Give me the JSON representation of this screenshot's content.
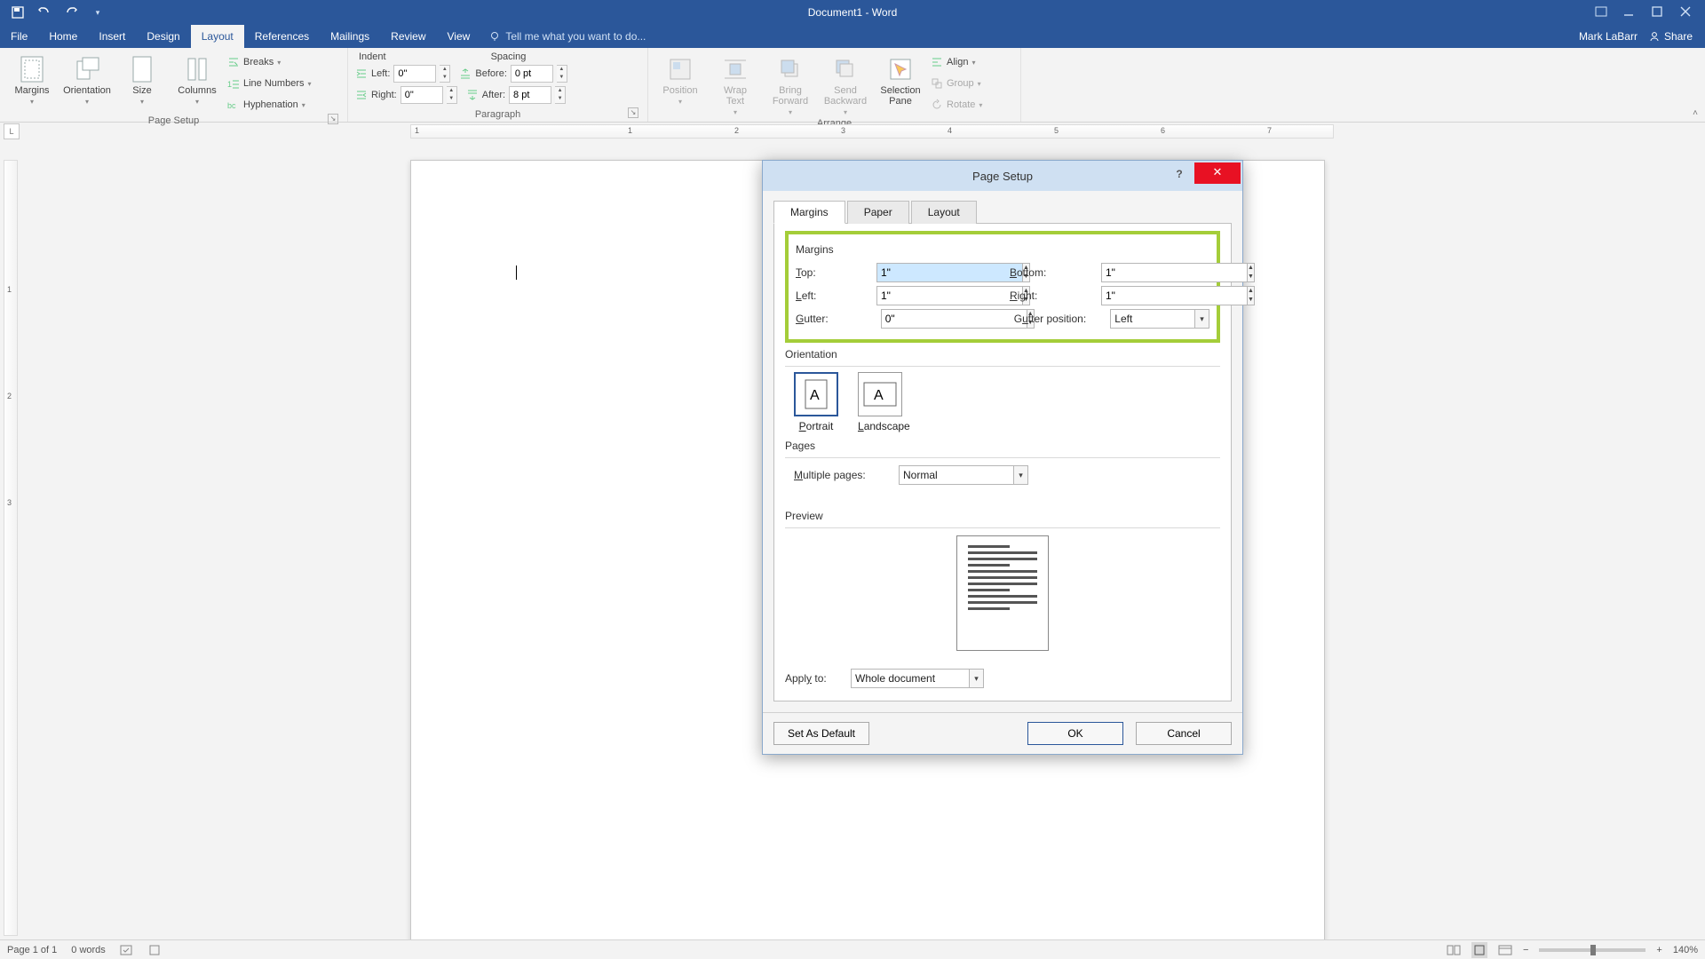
{
  "app": {
    "title": "Document1 - Word",
    "user": "Mark LaBarr",
    "share": "Share"
  },
  "qat": {
    "save": "save",
    "undo": "undo",
    "redo": "redo"
  },
  "tabs": [
    "File",
    "Home",
    "Insert",
    "Design",
    "Layout",
    "References",
    "Mailings",
    "Review",
    "View"
  ],
  "active_tab": "Layout",
  "tellme": "Tell me what you want to do...",
  "ribbon": {
    "pagesetup": {
      "label": "Page Setup",
      "margins": "Margins",
      "orientation": "Orientation",
      "size": "Size",
      "columns": "Columns",
      "breaks": "Breaks",
      "linenumbers": "Line Numbers",
      "hyphenation": "Hyphenation"
    },
    "paragraph": {
      "label": "Paragraph",
      "indent": "Indent",
      "spacing": "Spacing",
      "left_lbl": "Left:",
      "left_val": "0\"",
      "right_lbl": "Right:",
      "right_val": "0\"",
      "before_lbl": "Before:",
      "before_val": "0 pt",
      "after_lbl": "After:",
      "after_val": "8 pt"
    },
    "arrange": {
      "label": "Arrange",
      "position": "Position",
      "wrap": "Wrap\nText",
      "bring": "Bring\nForward",
      "send": "Send\nBackward",
      "selpane": "Selection\nPane",
      "align": "Align",
      "group": "Group",
      "rotate": "Rotate"
    }
  },
  "dialog": {
    "title": "Page Setup",
    "tabs": {
      "margins": "Margins",
      "paper": "Paper",
      "layout": "Layout"
    },
    "margins": {
      "section": "Margins",
      "top_lbl": "Top:",
      "top": "1\"",
      "bottom_lbl": "Bottom:",
      "bottom": "1\"",
      "left_lbl": "Left:",
      "left": "1\"",
      "right_lbl": "Right:",
      "right": "1\"",
      "gutter_lbl": "Gutter:",
      "gutter": "0\"",
      "gutterpos_lbl": "Gutter position:",
      "gutterpos": "Left"
    },
    "orientation": {
      "section": "Orientation",
      "portrait": "Portrait",
      "landscape": "Landscape"
    },
    "pages": {
      "section": "Pages",
      "multi_lbl": "Multiple pages:",
      "multi": "Normal"
    },
    "preview": {
      "section": "Preview"
    },
    "apply": {
      "lbl": "Apply to:",
      "val": "Whole document"
    },
    "buttons": {
      "setdefault": "Set As Default",
      "ok": "OK",
      "cancel": "Cancel"
    }
  },
  "status": {
    "page": "Page 1 of 1",
    "words": "0 words",
    "zoom": "140%"
  }
}
